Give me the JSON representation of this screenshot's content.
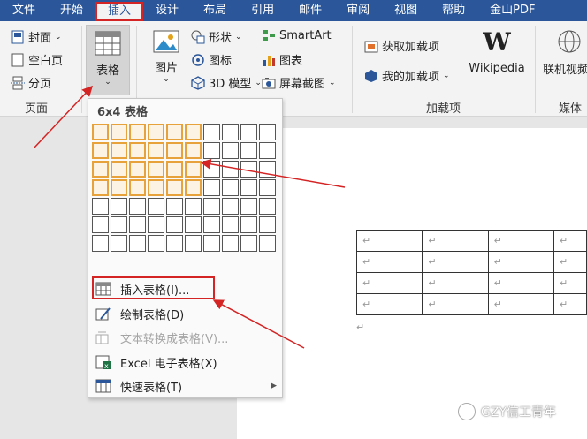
{
  "tabs": [
    "文件",
    "开始",
    "插入",
    "设计",
    "布局",
    "引用",
    "邮件",
    "审阅",
    "视图",
    "帮助",
    "金山PDF"
  ],
  "ribbon": {
    "pages_group": {
      "cover": "封面",
      "blank_page": "空白页",
      "page_break": "分页",
      "label": "页面"
    },
    "table_button": "表格",
    "illustrations": {
      "picture": "图片",
      "shapes": "形状",
      "icons": "图标",
      "model3d": "3D 模型",
      "smartart": "SmartArt",
      "chart": "图表",
      "screenshot": "屏幕截图"
    },
    "addins": {
      "get_addins": "获取加载项",
      "my_addins": "我的加载项",
      "wikipedia": "Wikipedia",
      "label": "加载项"
    },
    "media": {
      "online_video": "联机视频",
      "label": "媒体"
    }
  },
  "table_dropdown": {
    "title": "6x4 表格",
    "grid_cols": 10,
    "grid_rows": 7,
    "highlight_cols": 6,
    "highlight_rows": 4,
    "items": [
      {
        "label": "插入表格(I)...",
        "icon": "table-icon",
        "disabled": false
      },
      {
        "label": "绘制表格(D)",
        "icon": "pencil-table-icon",
        "disabled": false
      },
      {
        "label": "文本转换成表格(V)...",
        "icon": "text-to-table-icon",
        "disabled": true
      },
      {
        "label": "Excel 电子表格(X)",
        "icon": "excel-icon",
        "disabled": false
      },
      {
        "label": "快速表格(T)",
        "icon": "quick-table-icon",
        "disabled": false,
        "submenu": true
      }
    ]
  },
  "doc_table": {
    "rows": 4,
    "cols": 4,
    "cell_mark": "↵"
  },
  "paragraph_mark": "↵",
  "watermark": "GZY信工青年",
  "colors": {
    "accent": "#2b579a",
    "annotation": "#d42424",
    "highlight": "#e8a23c"
  }
}
